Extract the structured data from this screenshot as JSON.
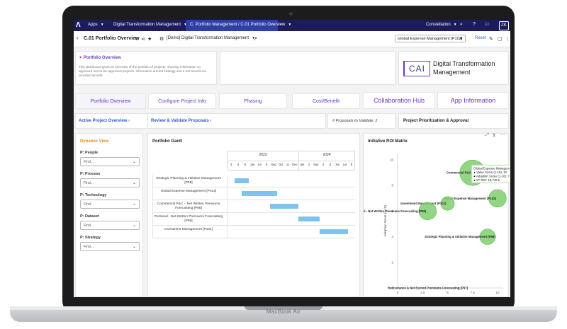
{
  "laptop": {
    "brand": "MacBook Air"
  },
  "topnav": {
    "logo": "Λ",
    "apps": "Apps",
    "module": "Digital Transformation Management",
    "active_tab": "C. Portfolio Management / C.01 Portfolio Overview",
    "user_menu": "Constellation",
    "avatar": "ZK"
  },
  "toolbar": {
    "back": "‹",
    "title": "C.01 Portfolio Overview",
    "workspace": "[Demo] Digital Transformation Management",
    "selector": "Global Expense Management [P102]",
    "reset": "Reset"
  },
  "overview": {
    "title": "Portfolio Overview",
    "description": "This dashboard gives an overview of the portfolio of projects, showing information on approved and to-be-approved projects. Information around strategy and £ net benefit are provided as well."
  },
  "logo_card": {
    "mark": "CAI",
    "line1": "Digital Transformation",
    "line2": "Management"
  },
  "tabs": [
    "Portfolio Overview",
    "Configure Project Info",
    "Phasing",
    "Cost/Benefit",
    "Collaboration Hub",
    "App Information"
  ],
  "links": {
    "active_project": "Active Project Overview ›",
    "review": "Review & Validate Proposals ›",
    "proposals": "# Proposals to Validate: 1",
    "prioritization": "Project Prioritization & Approval"
  },
  "dynamic_view": {
    "title": "Dynamic View",
    "filters": [
      {
        "label": "P: People",
        "placeholder": "Find..."
      },
      {
        "label": "P: Process",
        "placeholder": "Find..."
      },
      {
        "label": "P: Technology",
        "placeholder": "Find..."
      },
      {
        "label": "P: Dataset",
        "placeholder": "Find..."
      },
      {
        "label": "P: Strategy",
        "placeholder": "Find..."
      }
    ]
  },
  "gantt": {
    "title": "Portfolio Gantt",
    "years": [
      "2023",
      "2024"
    ],
    "months": [
      "3",
      "4",
      "5",
      "Jun",
      "Jul",
      "8",
      "Sep",
      "Oct",
      "11",
      "Dec",
      "Jan",
      "2",
      "Mar",
      "4",
      "5",
      "Jun",
      "Jul",
      "8"
    ],
    "rows": [
      {
        "label": "Strategic Planning & Initiative Management [P98]",
        "start": 1,
        "end": 3
      },
      {
        "label": "Global Expense Management [P102]",
        "start": 2,
        "end": 7
      },
      {
        "label": "Commercial P&C – Net Written Premiums Forecasting [P95]",
        "start": 6,
        "end": 10
      },
      {
        "label": "Personal - Net Written Premiums Forecasting [P96]",
        "start": 10,
        "end": 13
      },
      {
        "label": "Investment Management [P101]",
        "start": 13,
        "end": 17
      }
    ]
  },
  "roi": {
    "title": "Initiative ROI Matrix",
    "ylabel": "Adoption Score (1-10)",
    "tooltip": {
      "title": "Global Expense Management [P102]",
      "l1": "● Value Score (1-10): 10",
      "l2": "● Adoption Score (1-10): 7",
      "l3": "● 5Y ROI: 18,748 £"
    }
  },
  "chart_data": {
    "type": "scatter",
    "title": "Initiative ROI Matrix",
    "ylabel": "Adoption Score (1-10)",
    "xlabel": "",
    "xlim": [
      0,
      10.5
    ],
    "ylim": [
      0,
      10.5
    ],
    "xticks": [
      "0",
      "2.5",
      "5",
      "7.5",
      "10"
    ],
    "yticks": [
      "0",
      "2",
      "4",
      "6",
      "8",
      "10"
    ],
    "grid": false,
    "points": [
      {
        "name": "Commercial P&C",
        "x": 7.5,
        "y": 9,
        "size": 1.0
      },
      {
        "name": "Global Expense Management [P102]",
        "x": 10,
        "y": 7,
        "size": 0.6
      },
      {
        "name": "Investment Management [P101]",
        "x": 5,
        "y": 6.6,
        "size": 0.4
      },
      {
        "name": "Personal - Net Written Premiums Forecasting [P96]",
        "x": 3,
        "y": 6,
        "size": 0.6
      },
      {
        "name": "Strategic Planning & Initiative Management [P98]",
        "x": 9,
        "y": 4,
        "size": 0.5
      },
      {
        "name": "Reinsurance & Net Earned Premiums Forecasting [P97]",
        "x": 0,
        "y": 0,
        "size": 0.0
      }
    ]
  },
  "colors": {
    "nav": "#1b1b5e",
    "accent": "#6a39c4",
    "link": "#2a5bd7",
    "orange": "#e58b23",
    "bubble": "#7fcf6e",
    "bar": "#7ec3ec"
  }
}
